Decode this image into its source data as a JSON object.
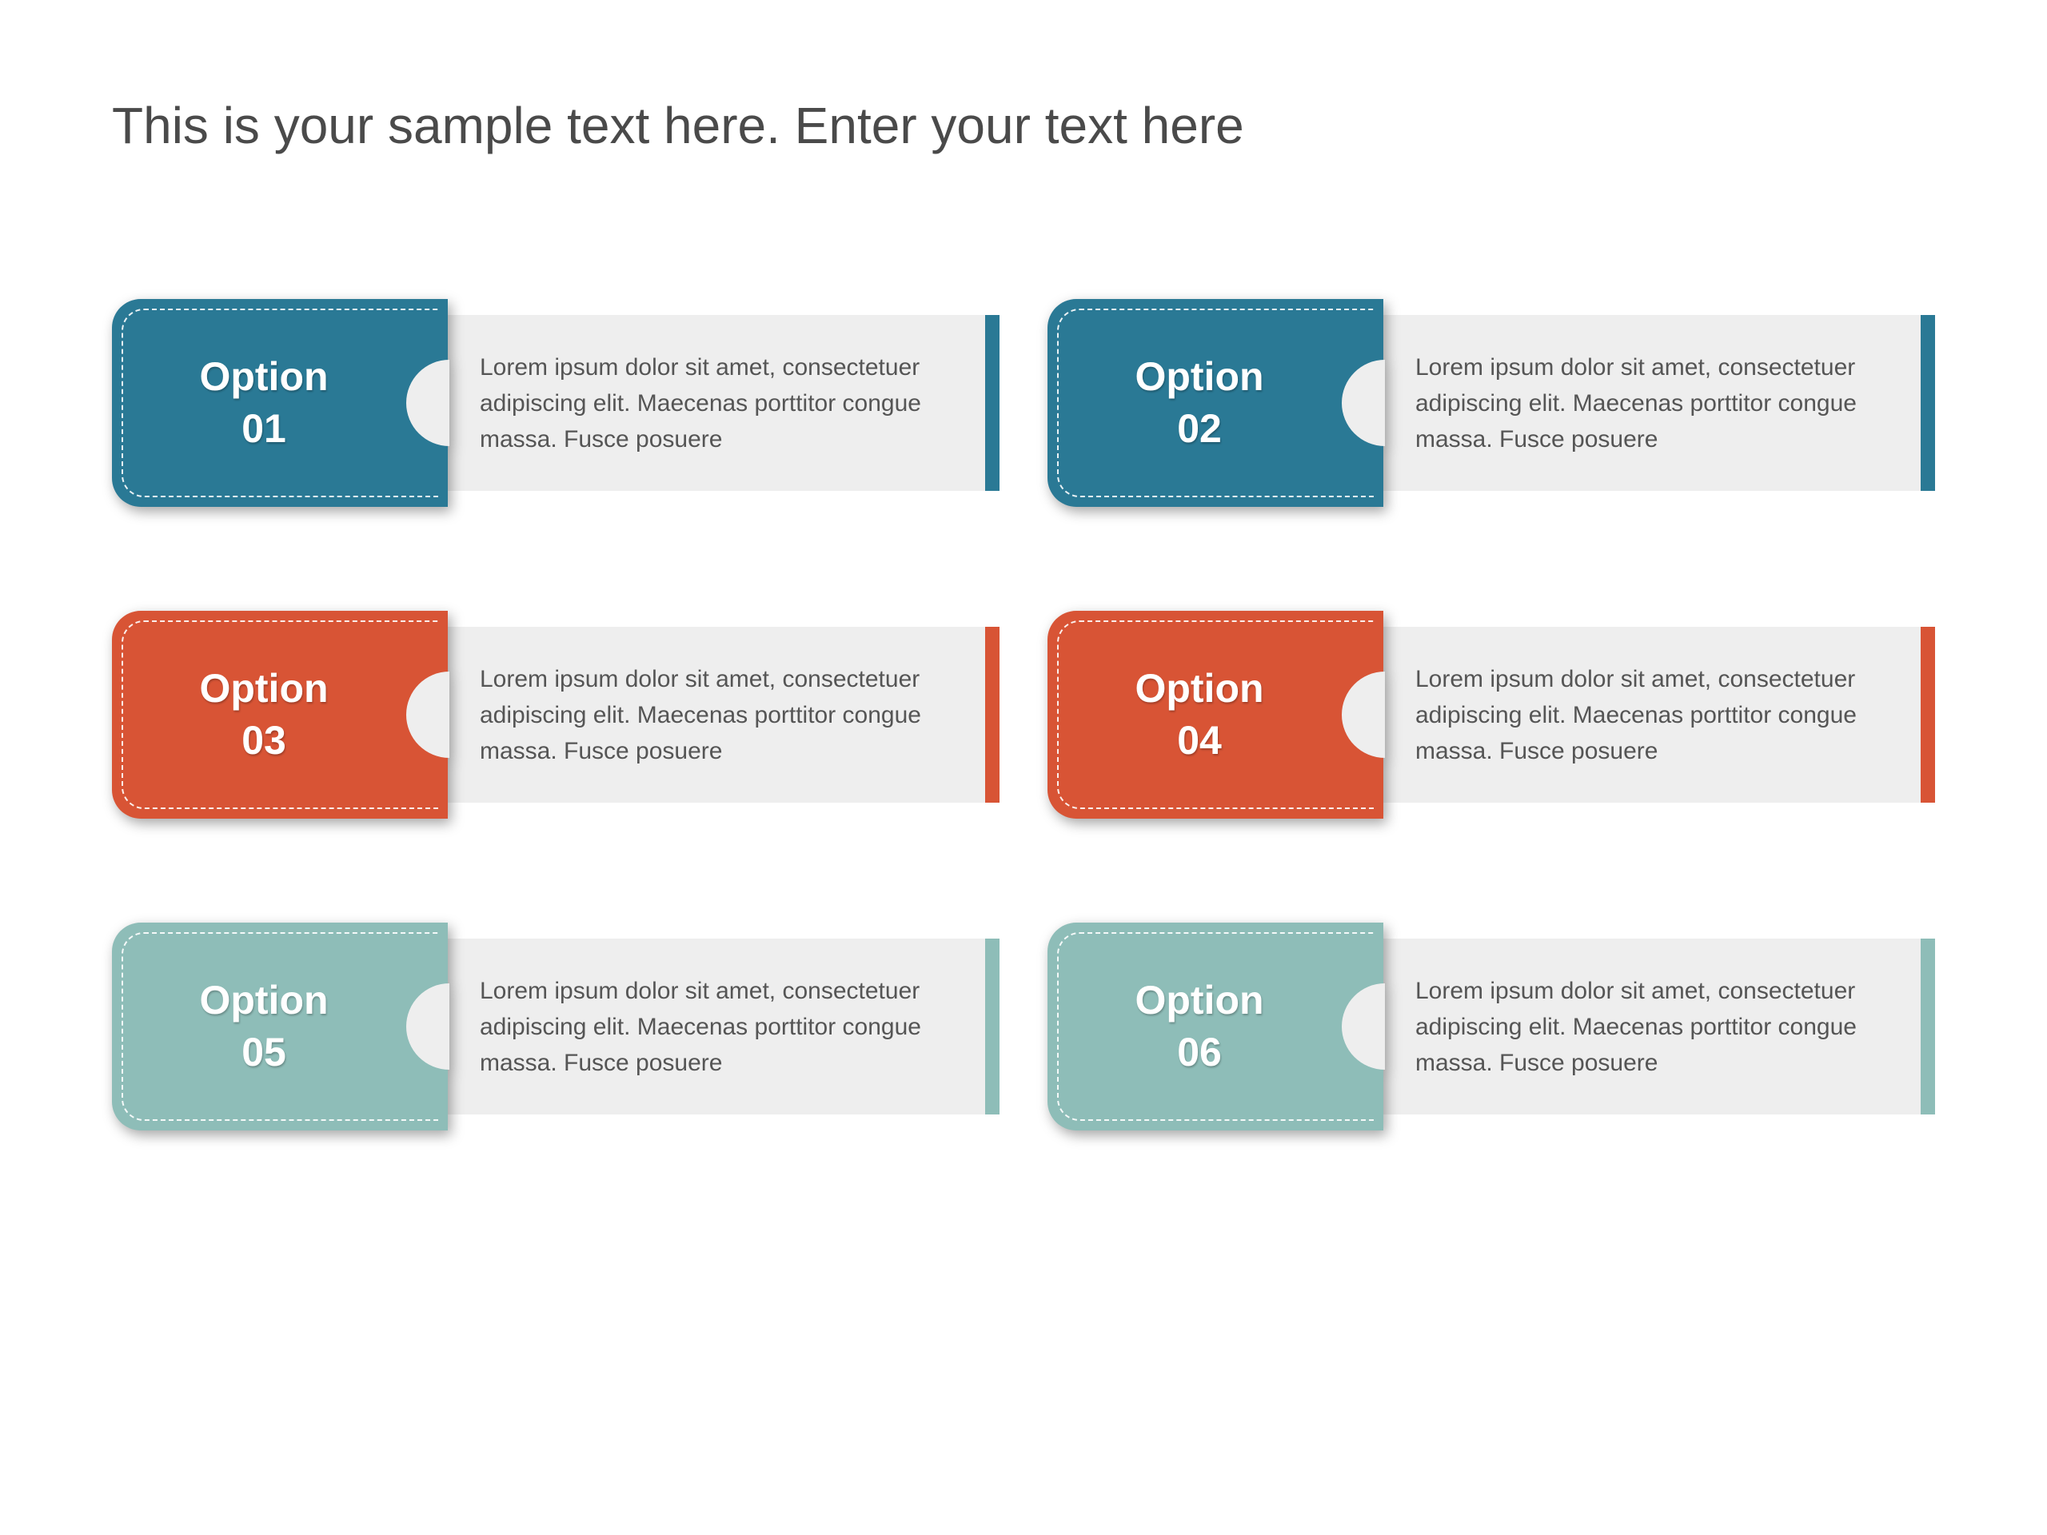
{
  "title": "This is your sample text here. Enter your text here",
  "body_text": "Lorem ipsum dolor sit amet, consectetuer adipiscing elit. Maecenas porttitor congue massa. Fusce posuere",
  "options": [
    {
      "label": "Option",
      "num": "01",
      "color": "teal"
    },
    {
      "label": "Option",
      "num": "02",
      "color": "teal"
    },
    {
      "label": "Option",
      "num": "03",
      "color": "orange"
    },
    {
      "label": "Option",
      "num": "04",
      "color": "orange"
    },
    {
      "label": "Option",
      "num": "05",
      "color": "sage"
    },
    {
      "label": "Option",
      "num": "06",
      "color": "sage"
    }
  ]
}
